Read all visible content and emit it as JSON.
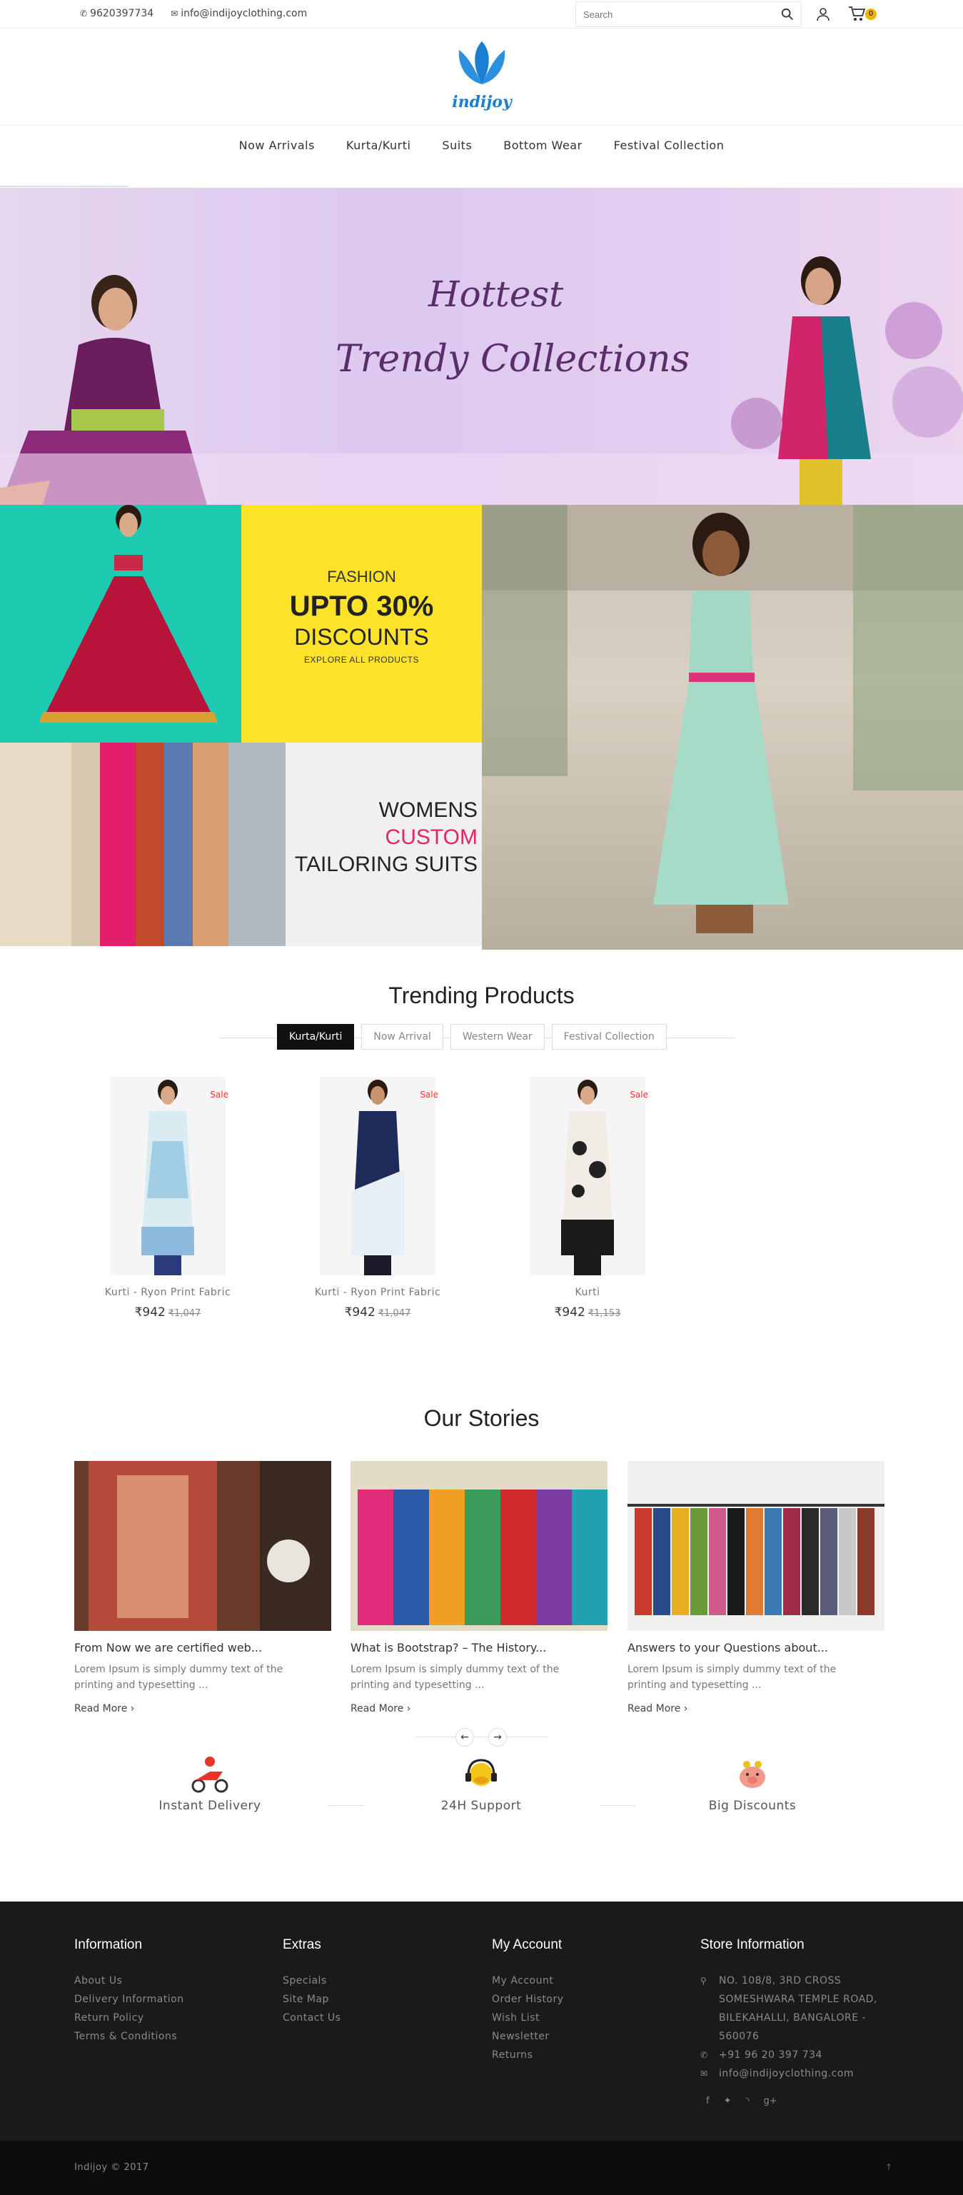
{
  "topbar": {
    "phone": "9620397734",
    "email": "info@indijoyclothing.com",
    "search_placeholder": "Search",
    "cart_count": "0"
  },
  "logo": {
    "brand": "indijoy"
  },
  "nav": {
    "items": [
      "Now Arrivals",
      "Kurta/Kurti",
      "Suits",
      "Bottom Wear",
      "Festival Collection"
    ]
  },
  "hero": {
    "line1": "Hottest",
    "line2": "Trendy Collections"
  },
  "banners": {
    "fashion": {
      "l1": "FASHION",
      "l2": "UPTO 30%",
      "l3": "DISCOUNTS",
      "l4": "EXPLORE ALL PRODUCTS"
    },
    "tailoring": {
      "l1": "WOMENS",
      "l2": "CUSTOM",
      "l3": "TAILORING SUITS"
    }
  },
  "trending": {
    "title": "Trending Products",
    "tabs": [
      "Kurta/Kurti",
      "Now Arrival",
      "Western Wear",
      "Festival Collection"
    ],
    "products": [
      {
        "badge": "Sale",
        "name": "Kurti - Ryon Print Fabric",
        "price": "₹942",
        "old_price": "₹1,047"
      },
      {
        "badge": "Sale",
        "name": "Kurti - Ryon Print Fabric",
        "price": "₹942",
        "old_price": "₹1,047"
      },
      {
        "badge": "Sale",
        "name": "Kurti",
        "price": "₹942",
        "old_price": "₹1,153"
      }
    ]
  },
  "stories": {
    "title": "Our Stories",
    "items": [
      {
        "title": "From Now we are certified web...",
        "desc": "Lorem Ipsum is simply dummy text of the printing and typesetting ...",
        "more": "Read More ›"
      },
      {
        "title": "What is Bootstrap? – The History...",
        "desc": "Lorem Ipsum is simply dummy text of the printing and typesetting ...",
        "more": "Read More ›"
      },
      {
        "title": "Answers to your Questions about...",
        "desc": "Lorem Ipsum is simply dummy text of the printing and typesetting ...",
        "more": "Read More ›"
      }
    ]
  },
  "features": [
    "Instant Delivery",
    "24H Support",
    "Big Discounts"
  ],
  "footer": {
    "information": {
      "title": "Information",
      "links": [
        "About Us",
        "Delivery Information",
        "Return Policy",
        "Terms & Conditions"
      ]
    },
    "extras": {
      "title": "Extras",
      "links": [
        "Specials",
        "Site Map",
        "Contact Us"
      ]
    },
    "account": {
      "title": "My Account",
      "links": [
        "My Account",
        "Order History",
        "Wish List",
        "Newsletter",
        "Returns"
      ]
    },
    "store": {
      "title": "Store Information",
      "address": "NO. 108/8, 3RD CROSS SOMESHWARA TEMPLE ROAD, BILEKAHALLI, BANGALORE - 560076",
      "phone": "+91 96 20 397 734",
      "email": "info@indijoyclothing.com"
    },
    "copyright": "Indijoy © 2017"
  }
}
